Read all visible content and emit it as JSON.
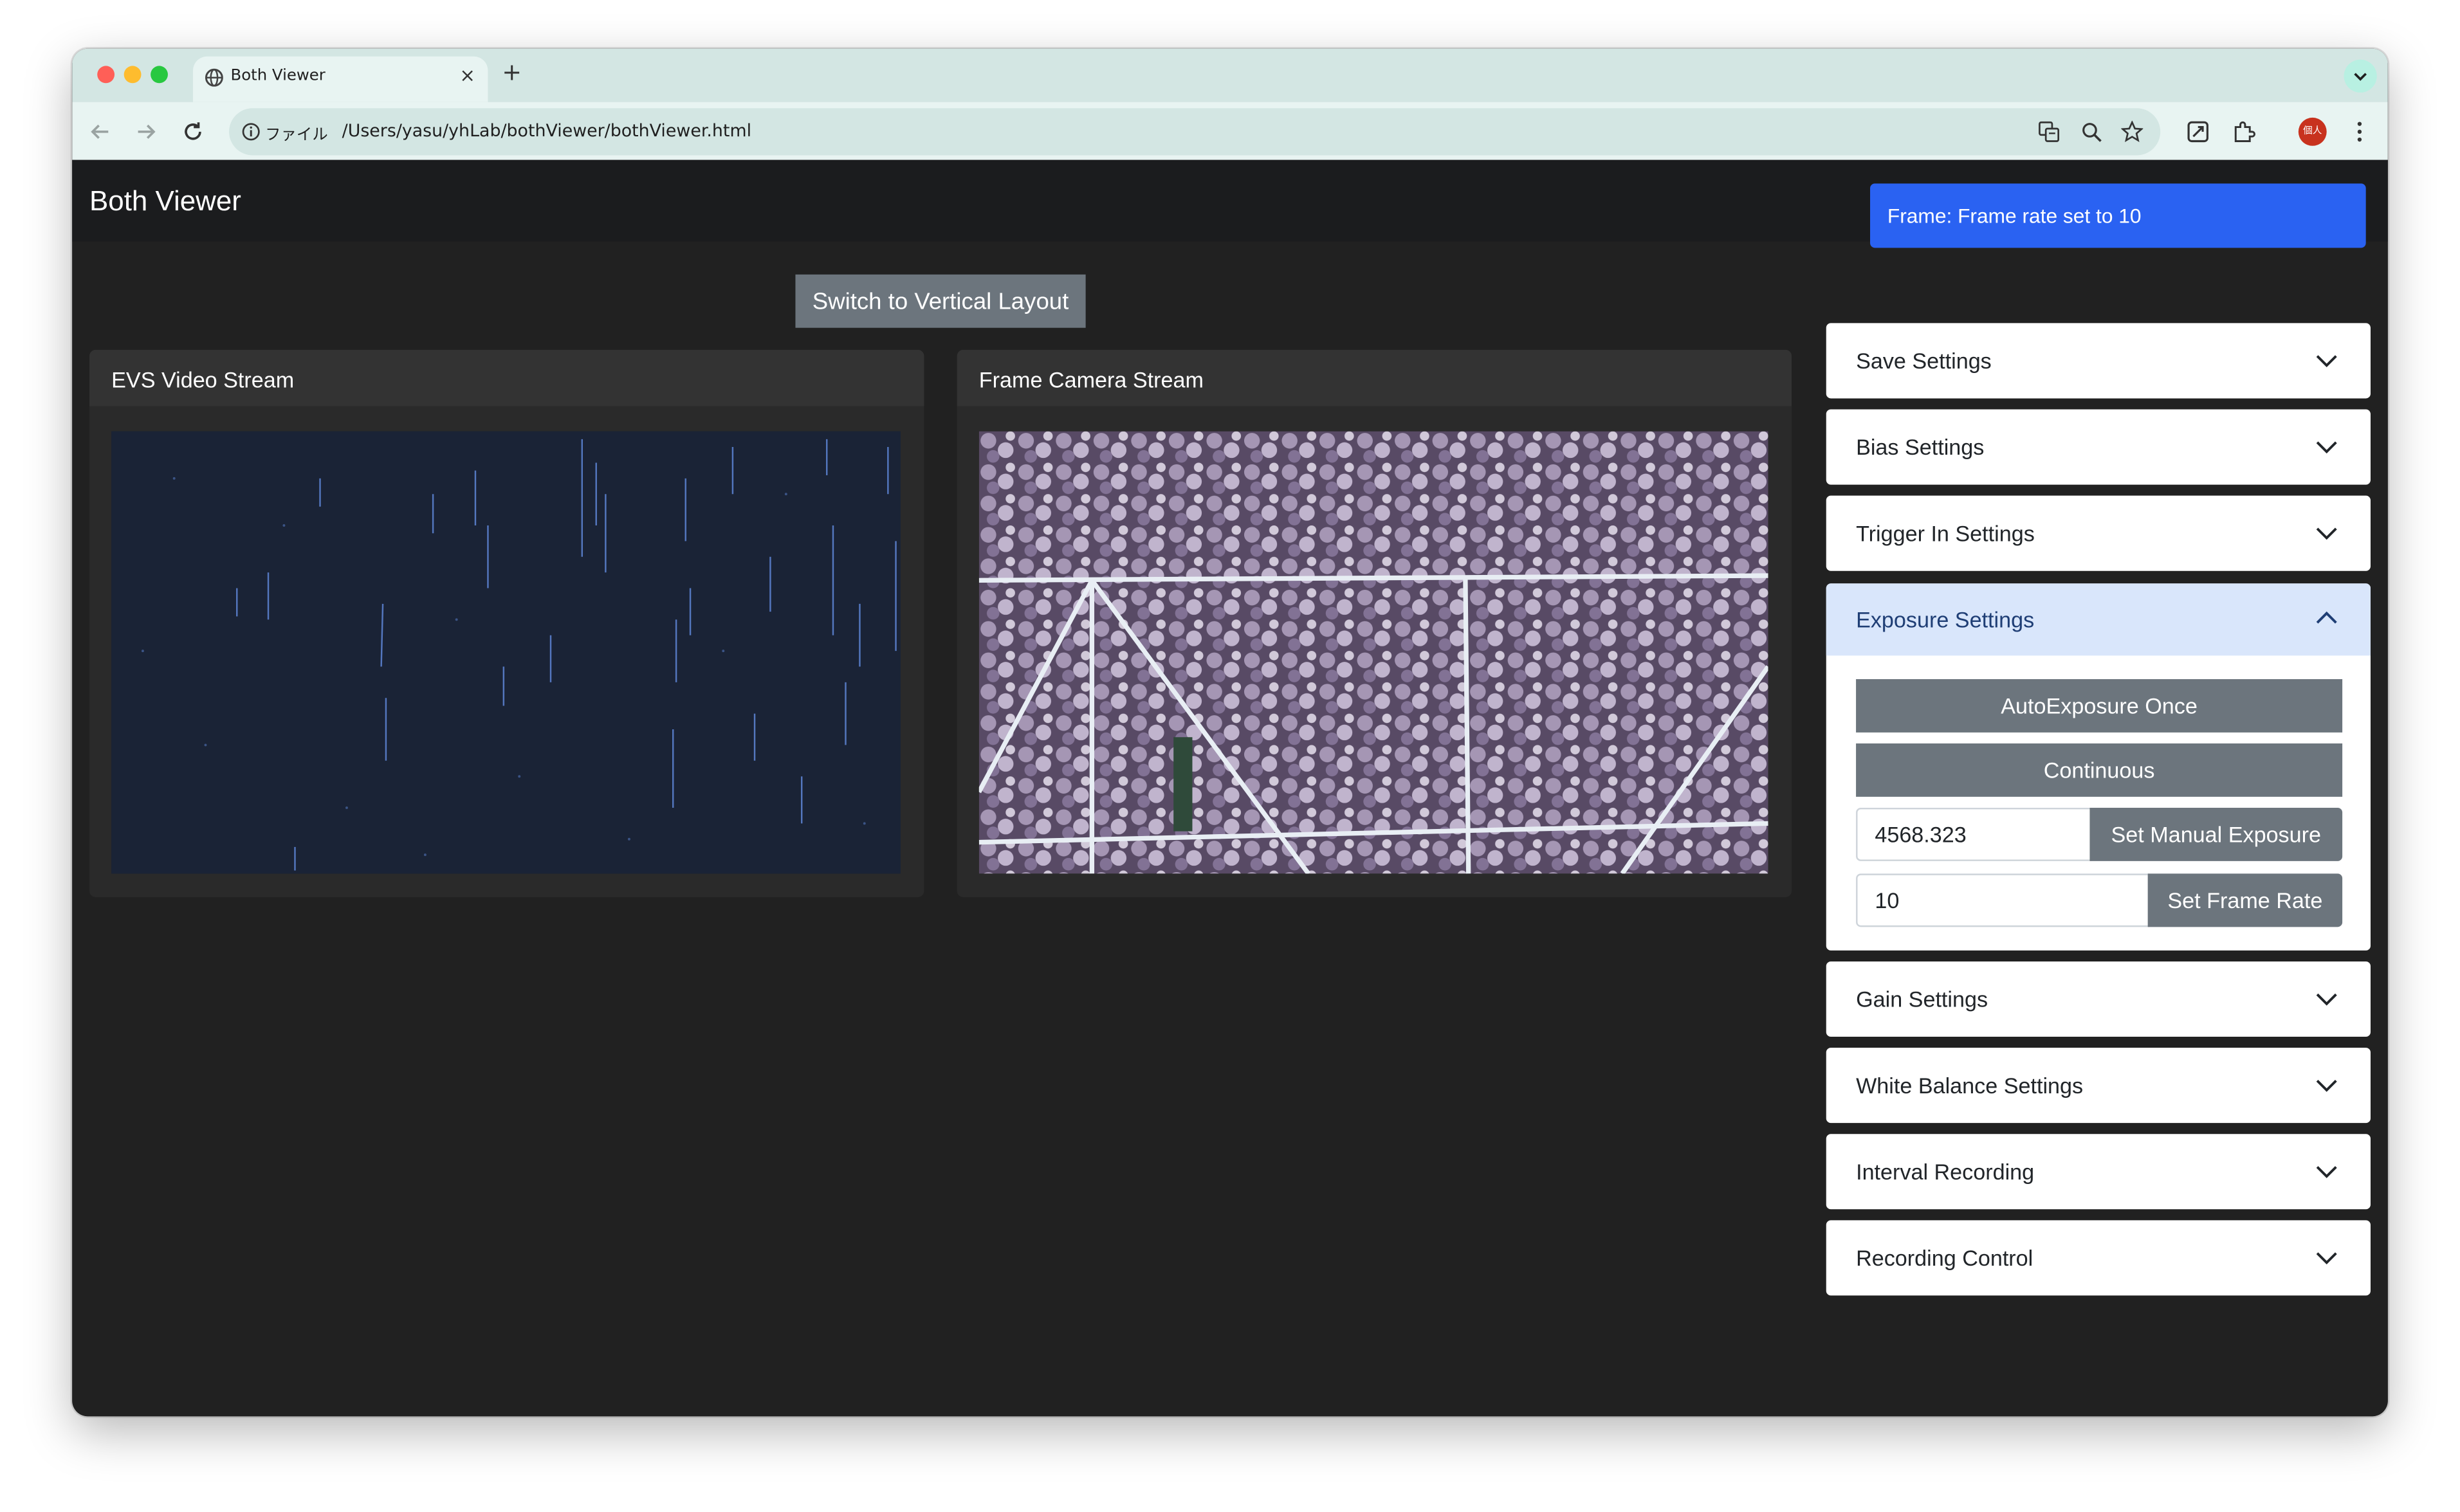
{
  "browser": {
    "tab_title": "Both Viewer",
    "tab_close": "×",
    "new_tab": "+",
    "scheme_label": "ファイル",
    "url": "/Users/yasu/yhLab/bothViewer/bothViewer.html",
    "profile_label": "個人"
  },
  "navbar": {
    "brand": "Both Viewer"
  },
  "toast": {
    "text": "Frame: Frame rate set to 10"
  },
  "layout_toggle": {
    "label": "Switch to Vertical Layout"
  },
  "streams": {
    "evs_title": "EVS Video Stream",
    "frame_title": "Frame Camera Stream"
  },
  "settings": {
    "save": "Save Settings",
    "bias": "Bias Settings",
    "trigger_in": "Trigger In Settings",
    "exposure": {
      "title": "Exposure Settings",
      "auto_once": "AutoExposure Once",
      "continuous": "Continuous",
      "manual_value": "4568.323",
      "manual_button": "Set Manual Exposure",
      "frame_rate_value": "10",
      "frame_rate_button": "Set Frame Rate"
    },
    "gain": "Gain Settings",
    "white_balance": "White Balance Settings",
    "interval_recording": "Interval Recording",
    "recording_control": "Recording Control"
  },
  "colors": {
    "toast_bg": "#2a62f2",
    "page_bg": "#212121",
    "secondary_btn": "#6c757d",
    "accordion_active": "#d9e6fb"
  }
}
